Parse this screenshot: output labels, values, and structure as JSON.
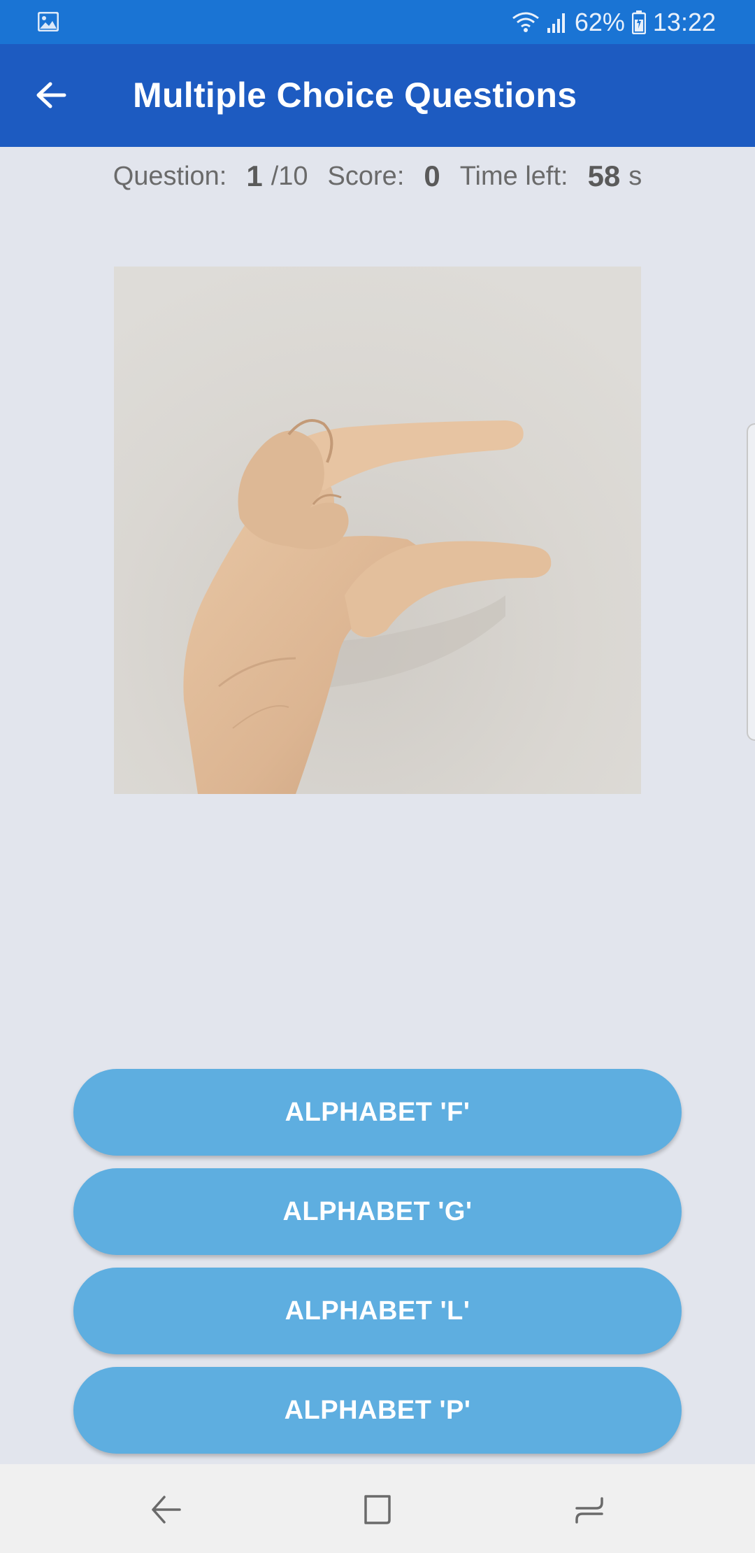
{
  "status_bar": {
    "battery_percent": "62%",
    "time": "13:22",
    "left_icon": "gallery-notification-icon",
    "icons": [
      "wifi-icon",
      "signal-icon",
      "battery-icon"
    ]
  },
  "app_bar": {
    "title": "Multiple Choice Questions",
    "back_icon": "arrow-left-icon"
  },
  "stats": {
    "question_label": "Question:",
    "question_number": "1",
    "question_total": "/10",
    "score_label": "Score:",
    "score_value": "0",
    "time_label": "Time left:",
    "time_value": "58",
    "time_unit": "s"
  },
  "question_image": {
    "icon": "hand-sign-photo"
  },
  "answers": [
    {
      "label": "ALPHABET 'F'"
    },
    {
      "label": "ALPHABET 'G'"
    },
    {
      "label": "ALPHABET 'L'"
    },
    {
      "label": "ALPHABET 'P'"
    }
  ],
  "nav_bar": {
    "icons": [
      "nav-back-icon",
      "nav-home-icon",
      "nav-recents-icon"
    ]
  },
  "colors": {
    "status_bar": "#1a74d4",
    "app_bar": "#1d5bc1",
    "background": "#e2e5ed",
    "answer_button": "#5eaee0",
    "nav_bar": "#f0f0f0"
  }
}
